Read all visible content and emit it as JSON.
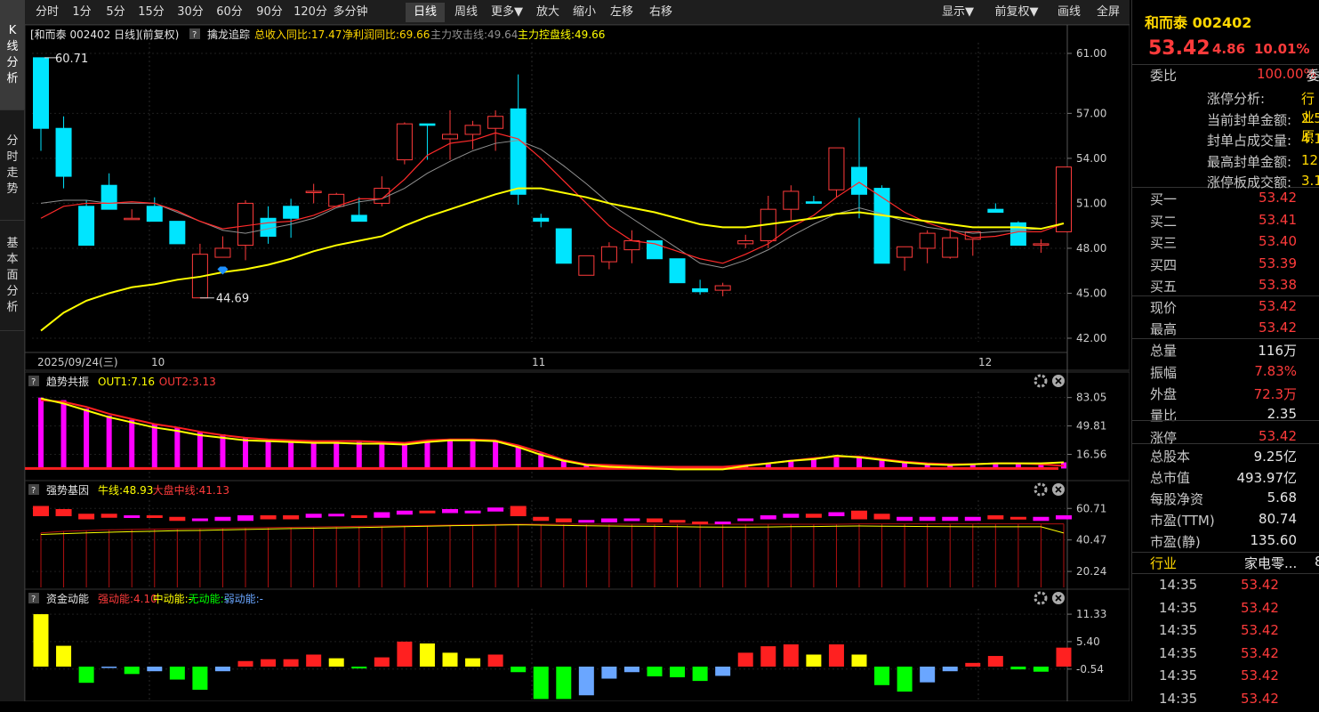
{
  "sidebar": {
    "tabs": [
      {
        "label": "K线分析",
        "active": true
      },
      {
        "label": "分时走势",
        "active": false
      },
      {
        "label": "基本面分析",
        "active": false
      }
    ]
  },
  "toolbar": {
    "left": [
      {
        "label": "分时"
      },
      {
        "label": "1分"
      },
      {
        "label": "5分"
      },
      {
        "label": "15分"
      },
      {
        "label": "30分"
      },
      {
        "label": "60分"
      },
      {
        "label": "90分"
      },
      {
        "label": "120分"
      },
      {
        "label": "多分钟"
      },
      {
        "label": "日线",
        "active": true
      },
      {
        "label": "周线"
      },
      {
        "label": "更多▼"
      },
      {
        "label": "放大"
      },
      {
        "label": "缩小"
      },
      {
        "label": "左移"
      },
      {
        "label": "右移"
      }
    ],
    "right": [
      {
        "label": "显示▼"
      },
      {
        "label": "前复权▼"
      },
      {
        "label": "画线"
      },
      {
        "label": "全屏"
      }
    ]
  },
  "main_panel": {
    "stock_label": "[和而泰 002402 日线]",
    "adjust_label": "(前复权)",
    "help": "?",
    "indicator_name": "擒龙追踪",
    "legend": [
      {
        "text": "总收入同比:17.47",
        "color": "#ffd700"
      },
      {
        "text": "净利润同比:69.66",
        "color": "#ffd700"
      },
      {
        "text": "主力攻击线:49.64",
        "color": "#909090"
      },
      {
        "text": "主力控盘线:49.66",
        "color": "#ffff00"
      }
    ],
    "y_ticks": [
      "61.00",
      "57.00",
      "54.00",
      "51.00",
      "48.00",
      "45.00",
      "42.00"
    ],
    "x_labels": [
      "2025/09/24(三)",
      "10",
      "11",
      "12"
    ],
    "max_label": "60.71",
    "min_label": "44.69"
  },
  "panel2": {
    "help": "?",
    "name": "趋势共振",
    "legend": [
      {
        "text": "OUT1:7.16",
        "color": "#ffff00"
      },
      {
        "text": "OUT2:3.13",
        "color": "#ff3b3b"
      }
    ],
    "y_ticks": [
      "83.05",
      "49.81",
      "16.56"
    ]
  },
  "panel3": {
    "help": "?",
    "name": "强势基因",
    "legend": [
      {
        "text": "牛线:48.93",
        "color": "#ffff00"
      },
      {
        "text": "大盘中线:41.13",
        "color": "#ff3b3b"
      }
    ],
    "y_ticks": [
      "60.71",
      "40.47",
      "20.24"
    ]
  },
  "panel4": {
    "help": "?",
    "name": "资金动能",
    "legend": [
      {
        "text": "强动能:4.10",
        "color": "#ff3b3b"
      },
      {
        "text": "中动能:-",
        "color": "#ffff00"
      },
      {
        "text": "无动能:-",
        "color": "#00ff00"
      },
      {
        "text": "弱动能:-",
        "color": "#6aa6ff"
      }
    ],
    "y_ticks": [
      "11.33",
      "5.40",
      "-0.54"
    ]
  },
  "quote": {
    "name_code": "和而泰 002402",
    "price": "53.42",
    "change": "4.86",
    "pct": "10.01%",
    "webi_label": "委比",
    "webi_value": "100.00%",
    "webi_tail": "委",
    "limit": [
      {
        "label": "涨停分析:",
        "value": "行业原"
      },
      {
        "label": "当前封单金额:",
        "value": "2.5"
      },
      {
        "label": "封单占成交量:",
        "value": "4.1"
      },
      {
        "label": "最高封单金额:",
        "value": "12"
      },
      {
        "label": "涨停板成交额:",
        "value": "3.1"
      }
    ],
    "book": [
      {
        "label": "买一",
        "value": "53.42"
      },
      {
        "label": "买二",
        "value": "53.41"
      },
      {
        "label": "买三",
        "value": "53.40"
      },
      {
        "label": "买四",
        "value": "53.39"
      },
      {
        "label": "买五",
        "value": "53.38"
      }
    ],
    "stats": [
      {
        "label": "现价",
        "value": "53.42",
        "color": "#ff3b3b"
      },
      {
        "label": "最高",
        "value": "53.42",
        "color": "#ff3b3b"
      },
      {
        "label": "总量",
        "value": "116万",
        "color": "#e6e6e6"
      },
      {
        "label": "振幅",
        "value": "7.83%",
        "color": "#ff3b3b"
      },
      {
        "label": "外盘",
        "value": "72.3万",
        "color": "#ff3b3b"
      },
      {
        "label": "量比",
        "value": "2.35",
        "color": "#e6e6e6"
      },
      {
        "label": "涨停",
        "value": "53.42",
        "color": "#ff3b3b"
      }
    ],
    "fund": [
      {
        "label": "总股本",
        "value": "9.25亿"
      },
      {
        "label": "总市值",
        "value": "493.97亿"
      },
      {
        "label": "每股净资",
        "value": "5.68"
      },
      {
        "label": "市盈(TTM)",
        "value": "80.74"
      },
      {
        "label": "市盈(静)",
        "value": "135.60"
      }
    ],
    "industry_label": "行业",
    "industry_value": "家电零...",
    "industry_tail": "8",
    "ticks": [
      {
        "time": "14:35",
        "price": "53.42"
      },
      {
        "time": "14:35",
        "price": "53.42"
      },
      {
        "time": "14:35",
        "price": "53.42"
      },
      {
        "time": "14:35",
        "price": "53.42"
      },
      {
        "time": "14:35",
        "price": "53.42"
      },
      {
        "time": "14:35",
        "price": "53.42"
      }
    ]
  },
  "colors": {
    "up": "#ff3b3b",
    "down": "#00e5ff",
    "ma_fast": "#ff2a2a",
    "ma_slow": "#ffff00",
    "ma_gray": "#909090",
    "bar_magenta": "#ff00ff",
    "grid": "#3a0000"
  },
  "chart_data": {
    "type": "candlestick",
    "ohlc": [
      [
        60.71,
        60.71,
        54.5,
        56.0
      ],
      [
        56.0,
        56.8,
        52.0,
        52.8
      ],
      [
        50.8,
        51.2,
        48.2,
        48.2
      ],
      [
        52.2,
        53.0,
        50.6,
        50.6
      ],
      [
        50.0,
        50.6,
        50.0,
        50.0
      ],
      [
        50.8,
        51.4,
        49.8,
        49.8
      ],
      [
        49.8,
        49.8,
        48.3,
        48.3
      ],
      [
        44.69,
        48.3,
        44.69,
        47.6
      ],
      [
        47.4,
        48.8,
        47.4,
        48.0
      ],
      [
        48.2,
        51.2,
        47.2,
        51.0
      ],
      [
        50.0,
        50.8,
        48.3,
        48.8
      ],
      [
        50.8,
        51.3,
        48.7,
        50.0
      ],
      [
        51.8,
        52.3,
        51.0,
        51.8
      ],
      [
        50.8,
        51.7,
        50.8,
        51.6
      ],
      [
        50.2,
        51.4,
        49.8,
        49.8
      ],
      [
        51.0,
        52.8,
        50.8,
        52.0
      ],
      [
        53.9,
        56.4,
        53.6,
        56.3
      ],
      [
        56.3,
        56.3,
        53.9,
        56.2
      ],
      [
        55.3,
        57.2,
        53.9,
        55.6
      ],
      [
        55.6,
        56.5,
        54.6,
        56.2
      ],
      [
        56.0,
        57.2,
        54.5,
        56.8
      ],
      [
        57.3,
        59.6,
        50.9,
        51.6
      ],
      [
        50.0,
        50.3,
        49.4,
        49.8
      ],
      [
        49.3,
        49.3,
        47.0,
        47.0
      ],
      [
        46.2,
        47.3,
        46.2,
        47.5
      ],
      [
        47.1,
        48.4,
        46.6,
        48.1
      ],
      [
        47.9,
        49.2,
        47.0,
        48.5
      ],
      [
        48.5,
        48.5,
        47.3,
        47.3
      ],
      [
        47.3,
        47.3,
        45.7,
        45.7
      ],
      [
        45.3,
        45.9,
        44.9,
        45.1
      ],
      [
        45.2,
        45.7,
        44.8,
        45.5
      ],
      [
        48.3,
        48.9,
        48.0,
        48.5
      ],
      [
        48.5,
        51.5,
        48.0,
        50.6
      ],
      [
        50.6,
        52.2,
        49.9,
        51.8
      ],
      [
        51.1,
        51.5,
        51.0,
        51.0
      ],
      [
        51.9,
        54.7,
        51.4,
        54.7
      ],
      [
        53.4,
        56.7,
        50.0,
        51.6
      ],
      [
        52.0,
        52.2,
        47.0,
        47.0
      ],
      [
        47.4,
        48.1,
        46.5,
        48.1
      ],
      [
        48.0,
        49.2,
        47.0,
        49.0
      ],
      [
        47.4,
        49.3,
        47.3,
        48.7
      ],
      [
        48.6,
        49.1,
        47.5,
        49.1
      ],
      [
        50.6,
        51.0,
        50.4,
        50.4
      ],
      [
        49.7,
        49.8,
        48.2,
        48.2
      ],
      [
        48.3,
        48.6,
        47.7,
        48.3
      ],
      [
        49.1,
        53.42,
        49.1,
        53.42
      ]
    ],
    "ma_fast": [
      50.0,
      50.8,
      51.0,
      51.0,
      51.1,
      51.0,
      50.5,
      49.8,
      49.3,
      49.5,
      49.7,
      49.8,
      50.2,
      50.8,
      51.3,
      51.3,
      52.6,
      54.2,
      55.0,
      55.2,
      55.7,
      55.3,
      54.0,
      52.5,
      51.0,
      49.5,
      48.5,
      48.3,
      47.8,
      47.3,
      47.0,
      47.6,
      48.3,
      49.4,
      50.2,
      51.4,
      52.4,
      51.4,
      50.4,
      49.7,
      49.2,
      48.7,
      48.8,
      49.1,
      49.1,
      49.65
    ],
    "ma_gray": [
      51.0,
      51.2,
      51.2,
      51.0,
      51.0,
      51.0,
      50.4,
      49.8,
      49.2,
      49.0,
      49.3,
      49.6,
      50.0,
      50.7,
      51.1,
      51.3,
      52.0,
      53.0,
      53.8,
      54.5,
      55.0,
      55.2,
      54.6,
      53.5,
      52.3,
      51.0,
      50.0,
      49.0,
      48.0,
      47.0,
      46.7,
      47.2,
      47.9,
      48.8,
      49.6,
      50.3,
      50.7,
      50.3,
      49.8,
      49.4,
      49.2,
      49.0,
      49.1,
      49.2,
      49.3,
      49.64
    ],
    "ma_slow": [
      42.5,
      43.7,
      44.5,
      45.0,
      45.4,
      45.6,
      45.9,
      46.1,
      46.4,
      46.6,
      46.9,
      47.3,
      47.8,
      48.2,
      48.5,
      48.8,
      49.5,
      50.1,
      50.6,
      51.1,
      51.6,
      52.0,
      52.0,
      51.7,
      51.4,
      51.0,
      50.7,
      50.4,
      50.0,
      49.6,
      49.4,
      49.4,
      49.6,
      49.8,
      50.0,
      50.3,
      50.4,
      50.2,
      50.0,
      49.8,
      49.6,
      49.4,
      49.4,
      49.4,
      49.3,
      49.66
    ],
    "ylim": [
      42.0,
      61.0
    ],
    "panel2": {
      "values": [
        83,
        80,
        70,
        62,
        57,
        52,
        48,
        43,
        40,
        36,
        34,
        33,
        32,
        32,
        31,
        30,
        29,
        33,
        34,
        34,
        33,
        27,
        18,
        10,
        5,
        4,
        3,
        2,
        1,
        1,
        1,
        4,
        6,
        10,
        12,
        15,
        14,
        11,
        8,
        6,
        5,
        5,
        6,
        6,
        6,
        7.16
      ],
      "out1": [
        82,
        76,
        68,
        60,
        54,
        48,
        44,
        39,
        36,
        33,
        32,
        31,
        30,
        30,
        29,
        29,
        28,
        31,
        33,
        33,
        32,
        25,
        16,
        9,
        4,
        2,
        1,
        0,
        -1,
        -1,
        -1,
        3,
        6,
        9,
        11,
        15,
        13,
        10,
        7,
        5,
        4,
        5,
        6,
        6,
        6,
        7.16
      ],
      "out2": [
        80,
        78,
        72,
        64,
        58,
        52,
        48,
        43,
        39,
        36,
        34,
        33,
        32,
        32,
        32,
        31,
        30,
        33,
        34,
        34,
        33,
        27,
        19,
        10,
        5,
        4,
        3,
        2,
        2,
        2,
        2,
        4,
        6,
        9,
        12,
        14,
        14,
        11,
        8,
        6,
        5,
        5,
        6,
        6,
        5,
        3.13
      ],
      "ylim": [
        -10,
        90
      ]
    },
    "panel3": {
      "bars": [
        [
          62,
          56
        ],
        [
          60,
          56
        ],
        [
          57,
          54
        ],
        [
          57,
          55
        ],
        [
          56,
          55
        ],
        [
          56,
          55
        ],
        [
          55,
          53
        ],
        [
          54,
          53
        ],
        [
          55,
          53
        ],
        [
          56,
          53
        ],
        [
          56,
          54
        ],
        [
          56,
          54
        ],
        [
          57,
          55
        ],
        [
          57,
          56
        ],
        [
          56,
          56
        ],
        [
          58,
          55
        ],
        [
          59,
          57
        ],
        [
          59,
          58
        ],
        [
          60,
          58
        ],
        [
          59,
          58
        ],
        [
          61,
          59
        ],
        [
          62,
          56
        ],
        [
          55,
          53
        ],
        [
          54,
          52
        ],
        [
          53,
          52
        ],
        [
          54,
          52
        ],
        [
          54,
          53
        ],
        [
          54,
          52
        ],
        [
          53,
          52
        ],
        [
          52,
          52
        ],
        [
          52,
          52
        ],
        [
          54,
          53
        ],
        [
          56,
          54
        ],
        [
          57,
          55
        ],
        [
          57,
          55
        ],
        [
          58,
          56
        ],
        [
          59,
          54
        ],
        [
          57,
          54
        ],
        [
          55,
          53
        ],
        [
          55,
          53
        ],
        [
          55,
          53
        ],
        [
          55,
          53
        ],
        [
          56,
          54
        ],
        [
          55,
          54
        ],
        [
          55,
          53
        ],
        [
          56,
          54
        ]
      ],
      "bull": [
        48.0,
        48.5,
        49.0,
        49.4,
        49.8,
        50.1,
        50.4,
        50.6,
        50.9,
        51.2,
        51.5,
        51.8,
        52.0,
        52.2,
        52.4,
        52.7,
        53.0,
        53.3,
        53.6,
        53.8,
        54.0,
        54.2,
        54.0,
        53.8,
        53.6,
        53.4,
        53.3,
        53.2,
        53.0,
        52.8,
        52.7,
        52.7,
        52.8,
        53.0,
        53.1,
        53.3,
        53.4,
        53.3,
        53.2,
        53.1,
        53.0,
        52.9,
        52.9,
        52.9,
        52.9,
        48.93
      ],
      "mid": [
        46,
        47,
        47.5,
        48,
        48.2,
        48.4,
        48.6,
        48.8,
        49,
        49.2,
        49.4,
        49.6,
        49.8,
        50,
        50.2,
        50.4,
        50.6,
        50.8,
        51,
        51.2,
        51.4,
        51.6,
        51.6,
        51.6,
        51.6,
        51.6,
        51.6,
        51.6,
        51.6,
        51.6,
        51.6,
        51.6,
        51.6,
        51.6,
        51.6,
        51.6,
        51.8,
        51.8,
        51.8,
        51.8,
        51.8,
        51.8,
        51.8,
        51.8,
        51.8,
        51.8
      ],
      "ylim": [
        10,
        66
      ]
    },
    "panel4": {
      "values": [
        11.33,
        4.5,
        -3.5,
        -0.3,
        -1.6,
        -1.0,
        -2.8,
        -5.0,
        -1.0,
        1.2,
        1.6,
        1.6,
        2.6,
        1.8,
        -0.4,
        2.0,
        5.4,
        5.0,
        3.0,
        1.8,
        2.6,
        -1.2,
        -7.0,
        -7.0,
        -6.2,
        -2.6,
        -1.2,
        -2.1,
        -2.3,
        -3.1,
        -2.0,
        3.0,
        4.4,
        4.8,
        2.6,
        4.8,
        2.6,
        -4.0,
        -5.4,
        -3.4,
        -1.0,
        0.8,
        2.3,
        -0.6,
        -1.1,
        4.1
      ],
      "colors": [
        "#ffff00",
        "#ffff00",
        "#00ff00",
        "#6aa6ff",
        "#00ff00",
        "#6aa6ff",
        "#00ff00",
        "#00ff00",
        "#6aa6ff",
        "#ff2020",
        "#ff2020",
        "#ff2020",
        "#ff2020",
        "#ffff00",
        "#00ff00",
        "#ff2020",
        "#ff2020",
        "#ffff00",
        "#ffff00",
        "#ffff00",
        "#ff2020",
        "#00ff00",
        "#00ff00",
        "#00ff00",
        "#6aa6ff",
        "#6aa6ff",
        "#6aa6ff",
        "#00ff00",
        "#00ff00",
        "#00ff00",
        "#6aa6ff",
        "#ff2020",
        "#ff2020",
        "#ff2020",
        "#ffff00",
        "#ff2020",
        "#ffff00",
        "#00ff00",
        "#00ff00",
        "#6aa6ff",
        "#6aa6ff",
        "#ff2020",
        "#ff2020",
        "#00ff00",
        "#00ff00",
        "#ff2020"
      ],
      "ylim": [
        -7.5,
        12.5
      ]
    }
  }
}
